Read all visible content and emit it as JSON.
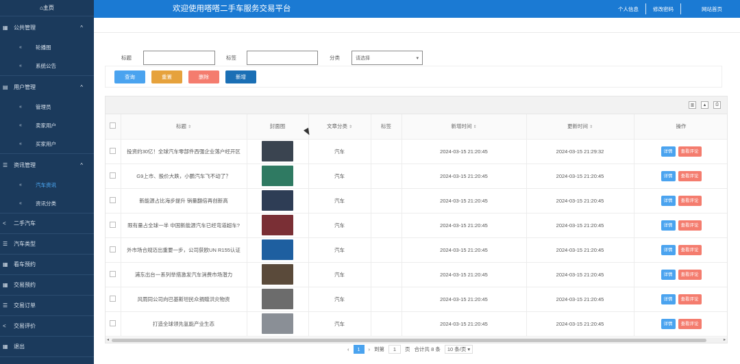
{
  "sidebar": {
    "home": "⌂主页",
    "groups": [
      {
        "icon": "▦",
        "label": "公共管理",
        "subs": [
          "轮播图",
          "系统公告"
        ]
      },
      {
        "icon": "▤",
        "label": "用户管理",
        "subs": [
          "管理员",
          "卖家用户",
          "买家用户"
        ]
      },
      {
        "icon": "☰",
        "label": "资讯管理",
        "subs": [
          "汽车资讯",
          "资讯分类"
        ]
      }
    ],
    "items": [
      {
        "icon": "<",
        "label": "二手汽车"
      },
      {
        "icon": "☰",
        "label": "汽车类型"
      },
      {
        "icon": "▦",
        "label": "看车预约"
      },
      {
        "icon": "▦",
        "label": "交易预约"
      },
      {
        "icon": "☰",
        "label": "交易订单"
      },
      {
        "icon": "<",
        "label": "交易评价"
      },
      {
        "icon": "▦",
        "label": "退出"
      }
    ]
  },
  "header": {
    "title": "欢迎使用嗒嗒二手车服务交易平台",
    "nav": [
      "个人信息",
      "修改密码",
      "网站首页"
    ]
  },
  "search": {
    "title_label": "标题",
    "tag_label": "标签",
    "category_label": "分类",
    "category_placeholder": "请选择"
  },
  "buttons": {
    "query": "查询",
    "reset": "重置",
    "delete": "删除",
    "add": "新增"
  },
  "table": {
    "headers": {
      "title": "标题",
      "cover": "封面图",
      "category": "文章分类",
      "tag": "标签",
      "created": "新增时间",
      "updated": "更新时间",
      "ops": "操作"
    },
    "op_detail": "详情",
    "op_review": "查看评论",
    "rows": [
      {
        "title": "投资约30亿！全球汽车零部件西强企业落户经开区",
        "category": "汽车",
        "tag": "",
        "created": "2024-03-15 21:20:45",
        "updated": "2024-03-15 21:29:32",
        "thumb": "#3a4450"
      },
      {
        "title": "G9上市、股价大跌，小鹏汽车飞不动了？",
        "category": "汽车",
        "tag": "",
        "created": "2024-03-15 21:20:45",
        "updated": "2024-03-15 21:20:45",
        "thumb": "#2f7a62"
      },
      {
        "title": "新能源占比海步提升 销量翻倍再创新高",
        "category": "汽车",
        "tag": "",
        "created": "2024-03-15 21:20:45",
        "updated": "2024-03-15 21:20:45",
        "thumb": "#2e3d55"
      },
      {
        "title": "限有量占全球一半 中国新能源汽车已经弯道超车?",
        "category": "汽车",
        "tag": "",
        "created": "2024-03-15 21:20:45",
        "updated": "2024-03-15 21:20:45",
        "thumb": "#7a2f35"
      },
      {
        "title": "外市场合规迈出重要一步，公司获欧UN R155认证",
        "category": "汽车",
        "tag": "",
        "created": "2024-03-15 21:20:45",
        "updated": "2024-03-15 21:20:45",
        "thumb": "#1e5fa0"
      },
      {
        "title": "浦东出台一系列举措激发汽车消费市场潜力",
        "category": "汽车",
        "tag": "",
        "created": "2024-03-15 21:20:45",
        "updated": "2024-03-15 21:20:45",
        "thumb": "#5a4a3a"
      },
      {
        "title": "风雨同公司向巴基斯坦民众捐赠洪灾物资",
        "category": "汽车",
        "tag": "",
        "created": "2024-03-15 21:20:45",
        "updated": "2024-03-15 21:20:45",
        "thumb": "#6c6c6c"
      },
      {
        "title": "打造全球领先氢能产业生态",
        "category": "汽车",
        "tag": "",
        "created": "2024-03-15 21:20:45",
        "updated": "2024-03-15 21:20:45",
        "thumb": "#8a8f96"
      }
    ]
  },
  "pager": {
    "prev": "‹",
    "current": "1",
    "next": "›",
    "goto_label": "到第",
    "goto_value": "1",
    "page_unit": "页",
    "total": "合计共 8 条",
    "page_size": "10 条/页 ▾"
  }
}
